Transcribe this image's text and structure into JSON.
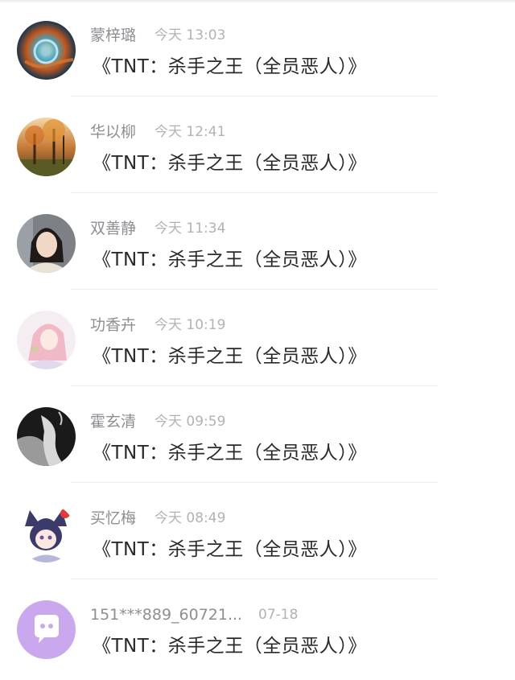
{
  "feed": {
    "items": [
      {
        "name": "蒙梓璐",
        "time": "今天 13:03",
        "content": "《TNT：杀手之王（全员恶人）》"
      },
      {
        "name": "华以柳",
        "time": "今天 12:41",
        "content": "《TNT：杀手之王（全员恶人）》"
      },
      {
        "name": "双善静",
        "time": "今天 11:34",
        "content": "《TNT：杀手之王（全员恶人）》"
      },
      {
        "name": "功香卉",
        "time": "今天 10:19",
        "content": "《TNT：杀手之王（全员恶人）》"
      },
      {
        "name": "霍玄清",
        "time": "今天 09:59",
        "content": "《TNT：杀手之王（全员恶人）》"
      },
      {
        "name": "买忆梅",
        "time": "今天 08:49",
        "content": "《TNT：杀手之王（全员恶人）》"
      },
      {
        "name": "151***889_60721...",
        "time": "07-18",
        "content": "《TNT：杀手之王（全员恶人）》"
      }
    ]
  },
  "colors": {
    "name": "#8e8e93",
    "time": "#b2b2b7",
    "content": "#2a2a2a",
    "default_avatar": "#c9a8ee"
  }
}
